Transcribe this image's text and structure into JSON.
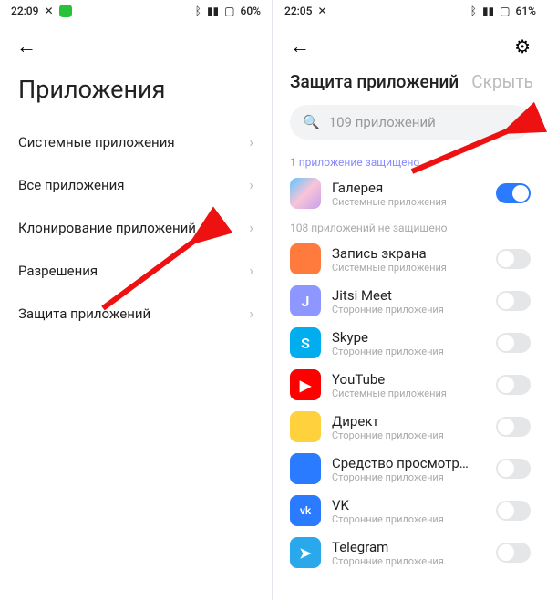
{
  "left": {
    "time": "22:09",
    "battery": "60%",
    "title": "Приложения",
    "items": [
      "Системные приложения",
      "Все приложения",
      "Клонирование приложений",
      "Разрешения",
      "Защита приложений"
    ]
  },
  "right": {
    "time": "22:05",
    "battery": "61%",
    "tabs": {
      "active": "Защита приложений",
      "inactive": "Скрыть"
    },
    "search_placeholder": "109 приложений",
    "section_protected": "1 приложение защищено",
    "section_unprotected": "108 приложений не защищено",
    "sub_system": "Системные приложения",
    "sub_third": "Сторонние приложения",
    "protected_app": {
      "name": "Галерея"
    },
    "apps": [
      {
        "name": "Запись экрана",
        "sub": "system",
        "icon_bg": "#ff7a3d",
        "letter": ""
      },
      {
        "name": "Jitsi Meet",
        "sub": "third",
        "icon_bg": "#8d97ff",
        "letter": "J"
      },
      {
        "name": "Skype",
        "sub": "third",
        "icon_bg": "#00aef0",
        "letter": "S"
      },
      {
        "name": "YouTube",
        "sub": "system",
        "icon_bg": "#ff0000",
        "letter": "▶"
      },
      {
        "name": "Директ",
        "sub": "third",
        "icon_bg": "#ffd23d",
        "letter": ""
      },
      {
        "name": "Средство просмотр…",
        "sub": "third",
        "icon_bg": "#2a7bff",
        "letter": ""
      },
      {
        "name": "VK",
        "sub": "third",
        "icon_bg": "#2a7bff",
        "letter": "vk"
      },
      {
        "name": "Telegram",
        "sub": "third",
        "icon_bg": "#29a9eb",
        "letter": "➤"
      }
    ]
  }
}
